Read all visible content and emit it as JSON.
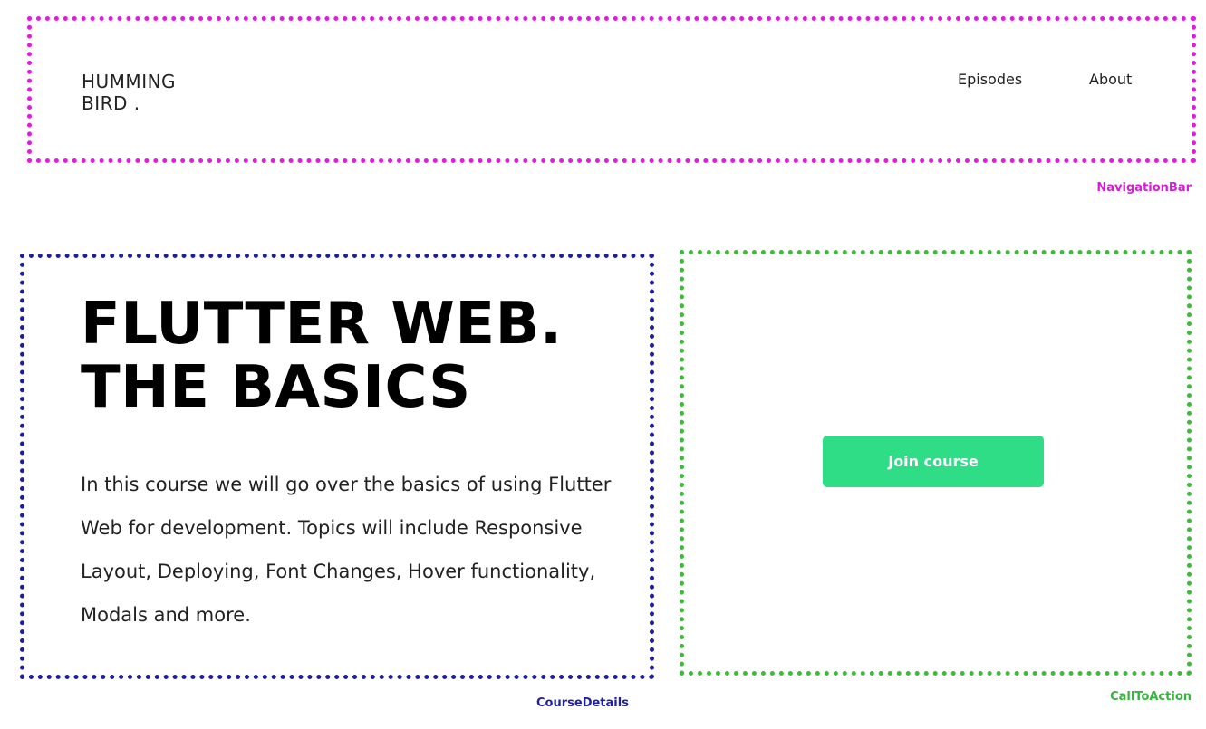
{
  "navigation_bar": {
    "logo_line1": "HUMMING",
    "logo_line2": "BIRD .",
    "links": [
      "Episodes",
      "About"
    ],
    "component_label": "NavigationBar",
    "border_color": "#e21be0"
  },
  "course_details": {
    "title_line1": "FLUTTER WEB.",
    "title_line2": "THE BASICS",
    "description": "In this course we will go over the basics of using Flutter Web for development. Topics will include Responsive Layout, Deploying, Font Changes, Hover functionality, Modals and more.",
    "component_label": "CourseDetails",
    "border_color": "#1f1f9a"
  },
  "call_to_action": {
    "button_label": "Join course",
    "button_color": "#2fdd86",
    "component_label": "CallToAction",
    "border_color": "#3fba3a"
  }
}
